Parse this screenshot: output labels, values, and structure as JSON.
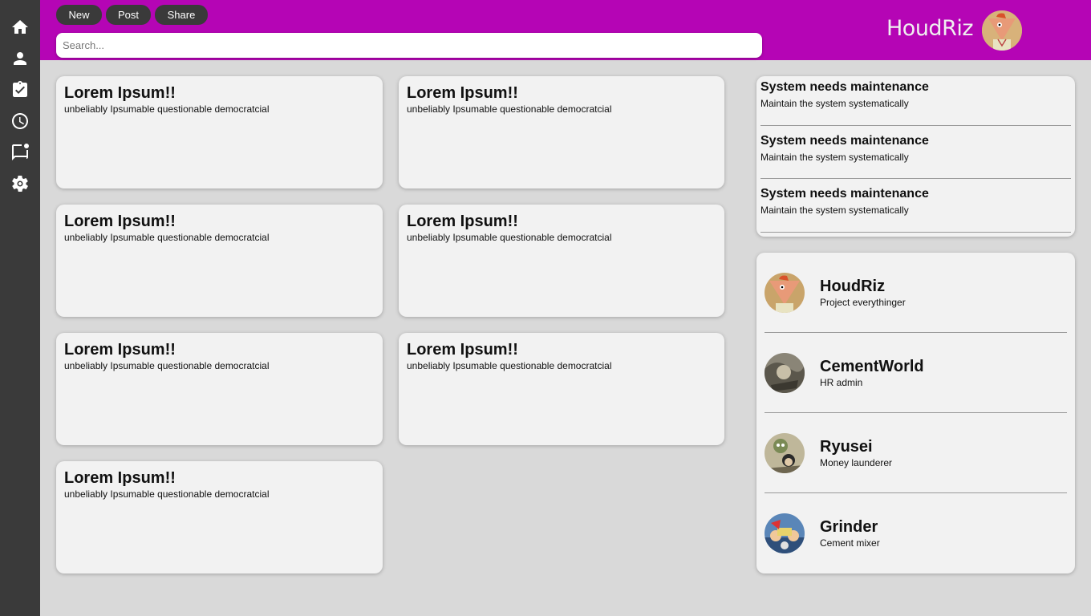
{
  "sidebar": {
    "items": [
      {
        "icon": "home-icon"
      },
      {
        "icon": "person-icon"
      },
      {
        "icon": "assignment-check-icon"
      },
      {
        "icon": "clock-icon"
      },
      {
        "icon": "chat-notification-icon"
      },
      {
        "icon": "gear-icon"
      }
    ]
  },
  "header": {
    "buttons": [
      "New",
      "Post",
      "Share"
    ],
    "search_placeholder": "Search...",
    "username": "HoudRiz",
    "background": "#b505b5"
  },
  "cards": [
    {
      "title": "Lorem Ipsum!!",
      "subtitle": "unbeliably Ipsumable questionable democratcial"
    },
    {
      "title": "Lorem Ipsum!!",
      "subtitle": "unbeliably Ipsumable questionable democratcial"
    },
    {
      "title": "Lorem Ipsum!!",
      "subtitle": "unbeliably Ipsumable questionable democratcial"
    },
    {
      "title": "Lorem Ipsum!!",
      "subtitle": "unbeliably Ipsumable questionable democratcial"
    },
    {
      "title": "Lorem Ipsum!!",
      "subtitle": "unbeliably Ipsumable questionable democratcial"
    },
    {
      "title": "Lorem Ipsum!!",
      "subtitle": "unbeliably Ipsumable questionable democratcial"
    },
    {
      "title": "Lorem Ipsum!!",
      "subtitle": "unbeliably Ipsumable questionable democratcial"
    }
  ],
  "notifications": [
    {
      "title": "System needs maintenance",
      "body": "Maintain the system systematically"
    },
    {
      "title": "System needs maintenance",
      "body": "Maintain the system systematically"
    },
    {
      "title": "System needs maintenance",
      "body": "Maintain the system systematically"
    }
  ],
  "users": [
    {
      "name": "HoudRiz",
      "role": "Project everythinger"
    },
    {
      "name": "CementWorld",
      "role": "HR admin"
    },
    {
      "name": "Ryusei",
      "role": "Money launderer"
    },
    {
      "name": "Grinder",
      "role": "Cement mixer"
    }
  ]
}
